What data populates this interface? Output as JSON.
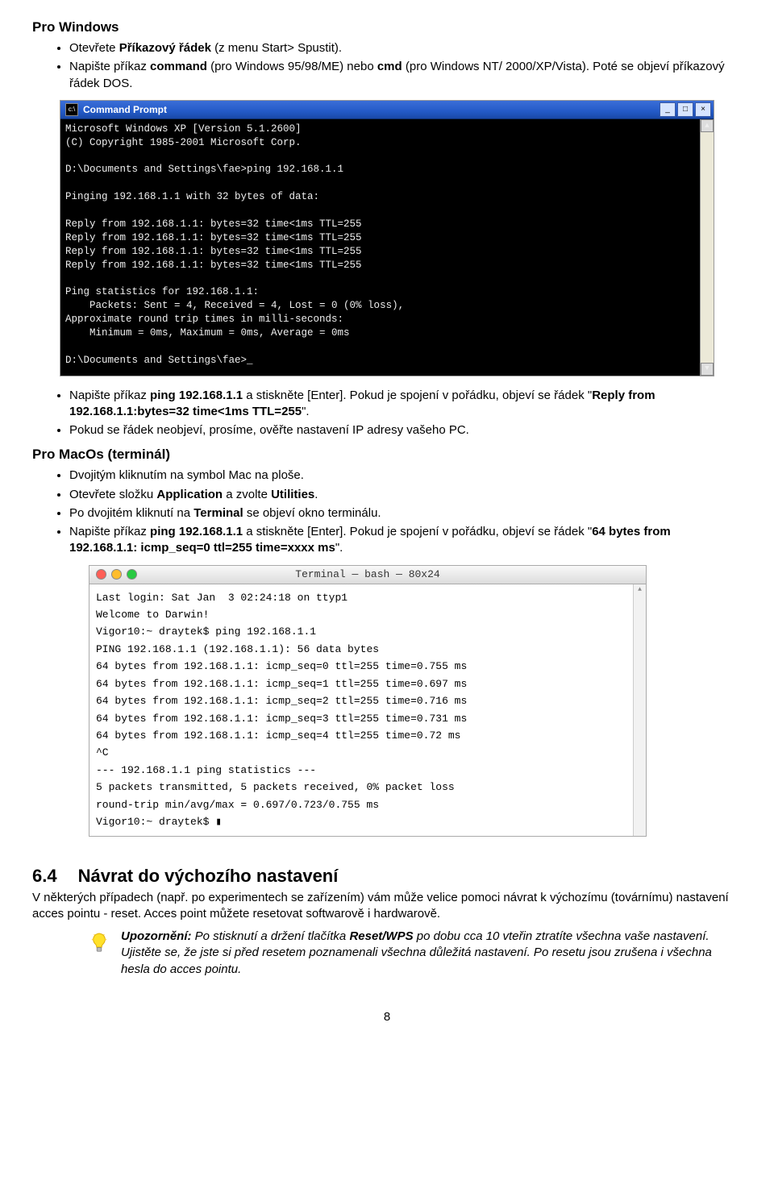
{
  "section_windows": "Pro Windows",
  "win_bullets": [
    {
      "pre": "Otevřete ",
      "b1": "Příkazový řádek",
      "post": " (z menu Start> Spustit)."
    },
    {
      "pre": "Napište příkaz ",
      "b1": "command",
      "mid1": " (pro Windows 95/98/ME) nebo ",
      "b2": "cmd",
      "post": " (pro Windows NT/ 2000/XP/Vista). Poté se objeví příkazový řádek DOS."
    }
  ],
  "cmd_title": "Command Prompt",
  "cmd_lines": "Microsoft Windows XP [Version 5.1.2600]\n(C) Copyright 1985-2001 Microsoft Corp.\n\nD:\\Documents and Settings\\fae>ping 192.168.1.1\n\nPinging 192.168.1.1 with 32 bytes of data:\n\nReply from 192.168.1.1: bytes=32 time<1ms TTL=255\nReply from 192.168.1.1: bytes=32 time<1ms TTL=255\nReply from 192.168.1.1: bytes=32 time<1ms TTL=255\nReply from 192.168.1.1: bytes=32 time<1ms TTL=255\n\nPing statistics for 192.168.1.1:\n    Packets: Sent = 4, Received = 4, Lost = 0 (0% loss),\nApproximate round trip times in milli-seconds:\n    Minimum = 0ms, Maximum = 0ms, Average = 0ms\n\nD:\\Documents and Settings\\fae>_",
  "ping_bullets": [
    {
      "pre": "Napište příkaz ",
      "b1": "ping 192.168.1.1",
      "mid": " a stiskněte [Enter]. Pokud je spojení v pořádku, objeví se řádek \"",
      "b2": "Reply from 192.168.1.1:bytes=32 time<1ms TTL=255",
      "post": "\"."
    },
    {
      "pre": "Pokud se řádek neobjeví, prosíme, ověřte nastavení IP adresy vašeho PC.",
      "b1": "",
      "mid": "",
      "b2": "",
      "post": ""
    }
  ],
  "section_mac": "Pro MacOs (terminál)",
  "mac_bullets": [
    {
      "pre": "Dvojitým kliknutím na symbol Mac na ploše.",
      "b1": "",
      "mid": "",
      "b2": "",
      "post": ""
    },
    {
      "pre": "Otevřete složku ",
      "b1": "Application",
      "mid": " a zvolte ",
      "b2": "Utilities",
      "post": "."
    },
    {
      "pre": "Po dvojitém kliknutí na ",
      "b1": "Terminal",
      "mid": " se objeví okno terminálu.",
      "b2": "",
      "post": ""
    },
    {
      "pre": "Napište příkaz ",
      "b1": "ping 192.168.1.1",
      "mid": " a stiskněte [Enter]. Pokud je spojení v pořádku, objeví se řádek \"",
      "b2": "64 bytes from 192.168.1.1: icmp_seq=0 ttl=255 time=xxxx ms",
      "post": "\"."
    }
  ],
  "mac_title": "Terminal — bash — 80x24",
  "mac_lines": "Last login: Sat Jan  3 02:24:18 on ttyp1\nWelcome to Darwin!\nVigor10:~ draytek$ ping 192.168.1.1\nPING 192.168.1.1 (192.168.1.1): 56 data bytes\n64 bytes from 192.168.1.1: icmp_seq=0 ttl=255 time=0.755 ms\n64 bytes from 192.168.1.1: icmp_seq=1 ttl=255 time=0.697 ms\n64 bytes from 192.168.1.1: icmp_seq=2 ttl=255 time=0.716 ms\n64 bytes from 192.168.1.1: icmp_seq=3 ttl=255 time=0.731 ms\n64 bytes from 192.168.1.1: icmp_seq=4 ttl=255 time=0.72 ms\n^C\n--- 192.168.1.1 ping statistics ---\n5 packets transmitted, 5 packets received, 0% packet loss\nround-trip min/avg/max = 0.697/0.723/0.755 ms\nVigor10:~ draytek$ ▮",
  "section_64": {
    "num": "6.4",
    "title": "Návrat do výchozího nastavení"
  },
  "para_64": "V některých případech (např. po experimentech se zařízením) vám může velice pomoci návrat k výchozímu (továrnímu) nastavení acces pointu - reset. Acces point můžete resetovat softwarově i hardwarově.",
  "note": {
    "b1": "Upozornění:",
    "mid1": " Po stisknutí a držení tlačítka ",
    "b2": "Reset/WPS",
    "post": " po dobu cca 10 vteřin ztratíte všechna vaše nastavení. Ujistěte se, že jste si před resetem poznamenali všechna důležitá nastavení. Po resetu jsou zrušena i všechna hesla do acces pointu."
  },
  "page_num": "8"
}
